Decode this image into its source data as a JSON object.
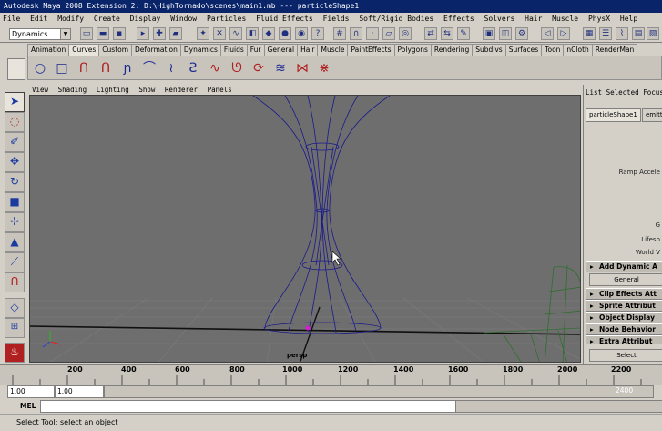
{
  "window": {
    "title": "Autodesk Maya 2008 Extension 2: D:\\HighTornado\\scenes\\main1.mb   ---   particleShape1"
  },
  "menus": [
    "File",
    "Edit",
    "Modify",
    "Create",
    "Display",
    "Window",
    "Particles",
    "Fluid Effects",
    "Fields",
    "Soft/Rigid Bodies",
    "Effects",
    "Solvers",
    "Hair",
    "Muscle",
    "PhysX",
    "Help"
  ],
  "status_line": {
    "mode": "Dynamics"
  },
  "shelf_tabs": [
    "Animation",
    "Curves",
    "Custom",
    "Deformation",
    "Dynamics",
    "Fluids",
    "Fur",
    "General",
    "Hair",
    "Muscle",
    "PaintEffects",
    "Polygons",
    "Rendering",
    "Subdivs",
    "Surfaces",
    "Toon",
    "nCloth",
    "RenderMan"
  ],
  "active_shelf_tab": "Curves",
  "panel_menu": [
    "View",
    "Shading",
    "Lighting",
    "Show",
    "Renderer",
    "Panels"
  ],
  "viewport": {
    "camera_label": "persp"
  },
  "attribute_editor": {
    "header_items": [
      "List",
      "Selected",
      "Focus"
    ],
    "tabs": [
      "particleShape1",
      "emitt"
    ],
    "labels": [
      "Ramp Accele",
      "G",
      "Lifesp",
      "World V"
    ],
    "sections": [
      "Add Dynamic A",
      "Clip Effects Att",
      "Sprite Attribut",
      "Object Display",
      "Node Behavior",
      "Extra Attribut"
    ],
    "general_button": "General",
    "select_button": "Select"
  },
  "timeline": {
    "ticks": [
      "200",
      "400",
      "600",
      "800",
      "1000",
      "1200",
      "1400",
      "1600",
      "1800",
      "2000",
      "2200"
    ]
  },
  "range": {
    "start": "1.00",
    "playback_start": "1.00",
    "end_value": "2400"
  },
  "command_line": {
    "label": "MEL"
  },
  "help_line": {
    "text": "Select Tool: select an object"
  },
  "colors": {
    "title_bg": "#0a246a",
    "viewport_bg": "#6e6e6e",
    "wireframe": "#1a1a8c",
    "ground": "#3a7a3a"
  }
}
